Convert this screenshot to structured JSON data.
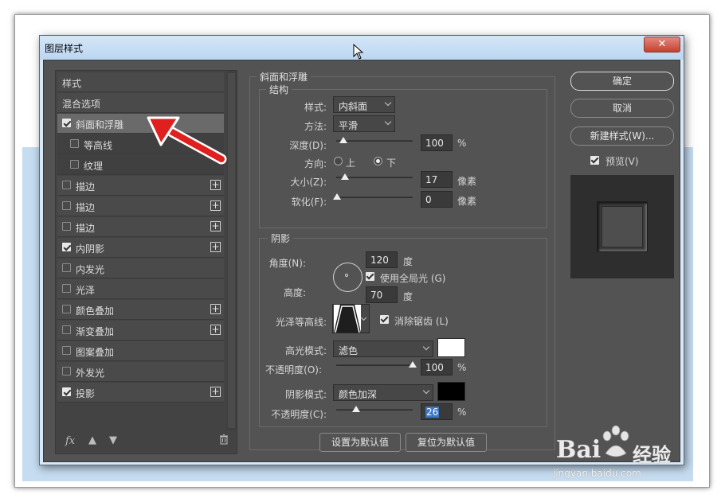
{
  "window": {
    "title": "图层样式",
    "close_label": "✕"
  },
  "left_list": {
    "header_items": [
      {
        "label": "样式"
      },
      {
        "label": "混合选项"
      }
    ],
    "effects": [
      {
        "label": "斜面和浮雕",
        "checked": true,
        "plus": false,
        "selected": true
      },
      {
        "label": "等高线",
        "checked": false,
        "plus": false,
        "sub": true
      },
      {
        "label": "纹理",
        "checked": false,
        "plus": false,
        "sub": true
      },
      {
        "label": "描边",
        "checked": false,
        "plus": true
      },
      {
        "label": "描边",
        "checked": false,
        "plus": true
      },
      {
        "label": "描边",
        "checked": false,
        "plus": true
      },
      {
        "label": "内阴影",
        "checked": true,
        "plus": true
      },
      {
        "label": "内发光",
        "checked": false,
        "plus": false
      },
      {
        "label": "光泽",
        "checked": false,
        "plus": false
      },
      {
        "label": "颜色叠加",
        "checked": false,
        "plus": true
      },
      {
        "label": "渐变叠加",
        "checked": false,
        "plus": true
      },
      {
        "label": "图案叠加",
        "checked": false,
        "plus": false
      },
      {
        "label": "外发光",
        "checked": false,
        "plus": false
      },
      {
        "label": "投影",
        "checked": true,
        "plus": true
      }
    ],
    "footer": {
      "fx_label": "fx",
      "up_icon": "arrow-up-icon",
      "down_icon": "arrow-down-icon",
      "trash_icon": "trash-icon"
    }
  },
  "bevel": {
    "group_title": "斜面和浮雕",
    "structure": {
      "title": "结构",
      "style_label": "样式:",
      "style_value": "内斜面",
      "method_label": "方法:",
      "method_value": "平滑",
      "depth_label": "深度(D):",
      "depth_value": "100",
      "depth_unit": "%",
      "direction_label": "方向:",
      "dir_up": "上",
      "dir_down": "下",
      "size_label": "大小(Z):",
      "size_value": "17",
      "size_unit": "像素",
      "soften_label": "软化(F):",
      "soften_value": "0",
      "soften_unit": "像素"
    },
    "shading": {
      "title": "阴影",
      "angle_label": "角度(N):",
      "angle_value": "120",
      "angle_unit": "度",
      "global_light_label": "使用全局光 (G)",
      "altitude_label": "高度:",
      "altitude_value": "70",
      "altitude_unit": "度",
      "gloss_label": "光泽等高线:",
      "antialias_label": "消除锯齿 (L)",
      "highlight_mode_label": "高光模式:",
      "highlight_mode_value": "滤色",
      "highlight_color": "#ffffff",
      "highlight_opacity_label": "不透明度(O):",
      "highlight_opacity_value": "100",
      "highlight_opacity_unit": "%",
      "shadow_mode_label": "阴影模式:",
      "shadow_mode_value": "颜色加深",
      "shadow_color": "#000000",
      "shadow_opacity_label": "不透明度(C):",
      "shadow_opacity_value": "26",
      "shadow_opacity_unit": "%"
    },
    "set_default_label": "设置为默认值",
    "reset_default_label": "复位为默认值"
  },
  "right": {
    "ok_label": "确定",
    "cancel_label": "取消",
    "new_style_label": "新建样式(W)...",
    "preview_label": "预览(V)"
  },
  "watermark": {
    "brand": "Bai",
    "brand2": "经验",
    "url": "jingyan.baidu.com"
  }
}
